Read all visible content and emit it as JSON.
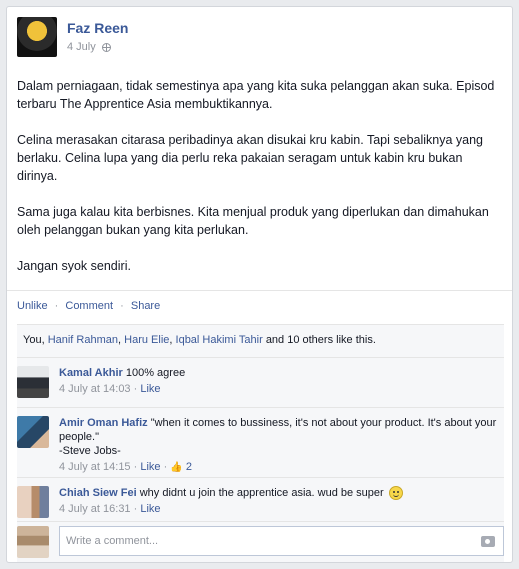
{
  "post": {
    "author": "Faz Reen",
    "date": "4 July",
    "paragraphs": [
      "Dalam perniagaan, tidak semestinya apa yang kita suka pelanggan akan suka. Episod terbaru The Apprentice Asia membuktikannya.",
      "Celina merasakan citarasa peribadinya akan disukai kru kabin. Tapi sebaliknya yang berlaku. Celina lupa yang dia perlu reka pakaian seragam untuk kabin kru bukan dirinya.",
      "Sama juga kalau kita berbisnes. Kita menjual produk yang diperlukan dan dimahukan oleh pelanggan bukan yang kita perlukan.",
      "Jangan syok sendiri."
    ]
  },
  "actions": {
    "unlike": "Unlike",
    "comment": "Comment",
    "share": "Share",
    "separator": "·"
  },
  "likes": {
    "prefix": "You,",
    "names": [
      "Hanif Rahman",
      "Haru Elie",
      "Iqbal Hakimi Tahir"
    ],
    "suffix": "and 10 others like this."
  },
  "comments": [
    {
      "name": "Kamal Akhir",
      "text": "100% agree",
      "time": "4 July at 14:03",
      "like_label": "Like"
    },
    {
      "name": "Amir Oman Hafiz",
      "text": "\"when it comes to bussiness, it's not about your product. It's about your people.\"",
      "text2": "-Steve Jobs-",
      "time": "4 July at 14:15",
      "like_label": "Like",
      "like_count": "2"
    },
    {
      "name": "Chiah Siew Fei",
      "text": "why didnt u join the apprentice asia. wud be super",
      "time": "4 July at 16:31",
      "like_label": "Like"
    }
  ],
  "composer": {
    "placeholder": "Write a comment..."
  }
}
